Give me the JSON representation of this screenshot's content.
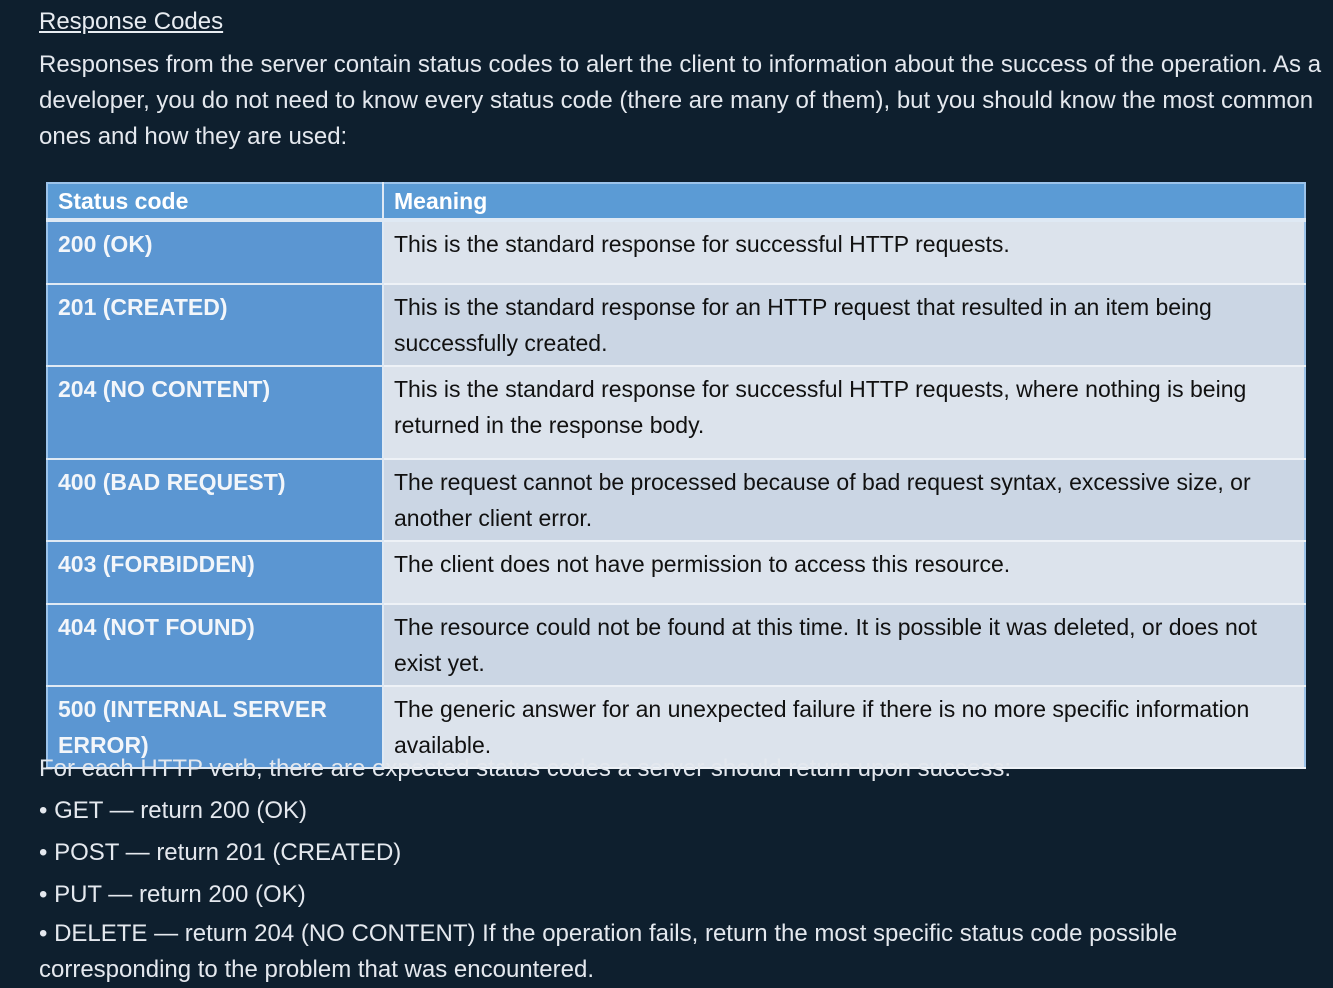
{
  "title": "Response Codes",
  "intro": "Responses from the server contain status codes to alert the client to information about the success of the operation. As a developer, you do not need to know every status code (there are many of them), but you should know the most common ones and how they are used:",
  "table": {
    "headers": [
      "Status code",
      "Meaning"
    ],
    "rows": [
      {
        "code": "200 (OK)",
        "meaning": "This is the standard response for successful HTTP requests."
      },
      {
        "code": "201 (CREATED)",
        "meaning": "This is the standard response for an HTTP request that resulted in an item being successfully created."
      },
      {
        "code": "204 (NO CONTENT)",
        "meaning": "This is the standard response for successful HTTP requests, where nothing is being returned in the response body."
      },
      {
        "code": "400 (BAD REQUEST)",
        "meaning": "The request cannot be processed because of bad request syntax, excessive size, or another client error."
      },
      {
        "code": "403 (FORBIDDEN)",
        "meaning": "The client does not have permission to access this resource."
      },
      {
        "code": "404 (NOT FOUND)",
        "meaning": "The resource could not be found at this time. It is possible it was deleted, or does not exist yet."
      },
      {
        "code": "500 (INTERNAL SERVER ERROR)",
        "meaning": "The generic answer for an unexpected failure if there is no more specific information available."
      }
    ]
  },
  "verbs_intro": "For each HTTP verb, there are expected status codes a server should return upon success:",
  "bullets": [
    "• GET — return 200 (OK)",
    "• POST — return 201 (CREATED)",
    "• PUT — return 200 (OK)",
    "• DELETE — return 204 (NO CONTENT) If the operation fails, return the most specific status code possible corresponding to the problem that was encountered."
  ]
}
